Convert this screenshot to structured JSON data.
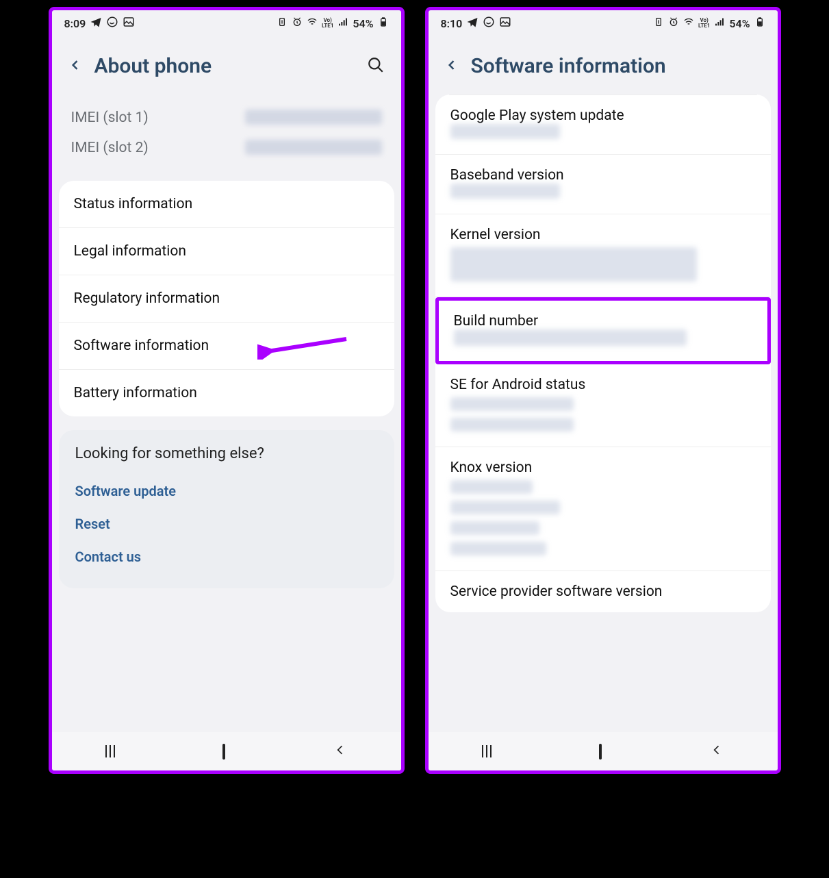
{
  "left": {
    "status": {
      "time": "8:09",
      "battery": "54%",
      "voLteLabel": "Vo)\nLTE1"
    },
    "title": "About phone",
    "imei": {
      "slot1Label": "IMEI (slot 1)",
      "slot2Label": "IMEI (slot 2)"
    },
    "items": [
      "Status information",
      "Legal information",
      "Regulatory information",
      "Software information",
      "Battery information"
    ],
    "suggest": {
      "heading": "Looking for something else?",
      "links": [
        "Software update",
        "Reset",
        "Contact us"
      ]
    }
  },
  "right": {
    "status": {
      "time": "8:10",
      "battery": "54%",
      "voLteLabel": "Vo)\nLTE1"
    },
    "title": "Software information",
    "items": [
      "Google Play system update",
      "Baseband version",
      "Kernel version",
      "Build number",
      "SE for Android status",
      "Knox version",
      "Service provider software version"
    ],
    "highlightIndex": 3
  },
  "annotations": {
    "arrowColor": "#aa00ff",
    "highlightColor": "#aa00ff"
  }
}
